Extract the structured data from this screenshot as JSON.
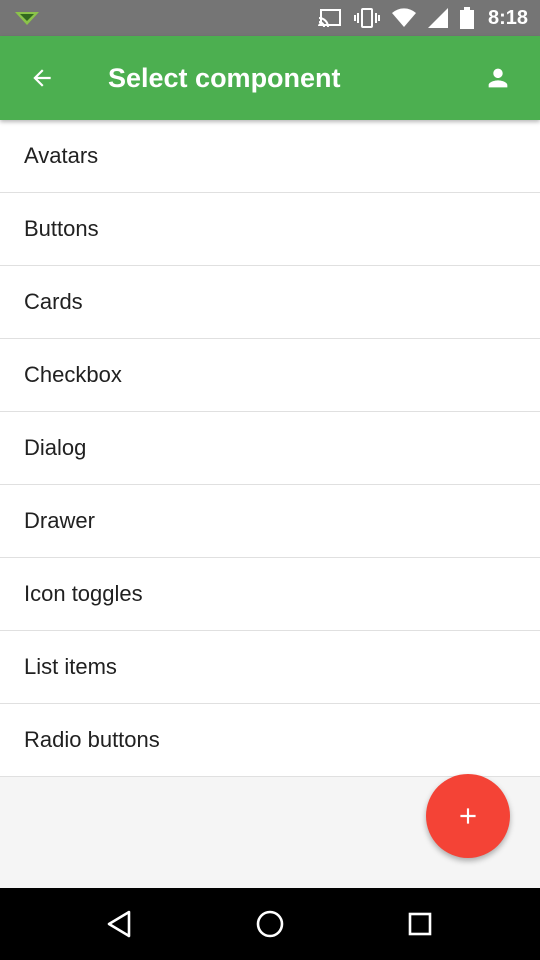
{
  "status_bar": {
    "time": "8:18",
    "icons": [
      "notification-icon",
      "cast-icon",
      "vibrate-icon",
      "wifi-icon",
      "signal-icon",
      "battery-icon"
    ]
  },
  "app_bar": {
    "title": "Select component",
    "back_icon": "arrow-back-icon",
    "account_icon": "person-icon",
    "color": "#4caf50"
  },
  "list": {
    "items": [
      {
        "label": "Avatars"
      },
      {
        "label": "Buttons"
      },
      {
        "label": "Cards"
      },
      {
        "label": "Checkbox"
      },
      {
        "label": "Dialog"
      },
      {
        "label": "Drawer"
      },
      {
        "label": "Icon toggles"
      },
      {
        "label": "List items"
      },
      {
        "label": "Radio buttons"
      }
    ]
  },
  "fab": {
    "icon": "plus-icon",
    "color": "#f44336"
  },
  "nav_bar": {
    "icons": [
      "nav-back-icon",
      "nav-home-icon",
      "nav-recents-icon"
    ]
  }
}
